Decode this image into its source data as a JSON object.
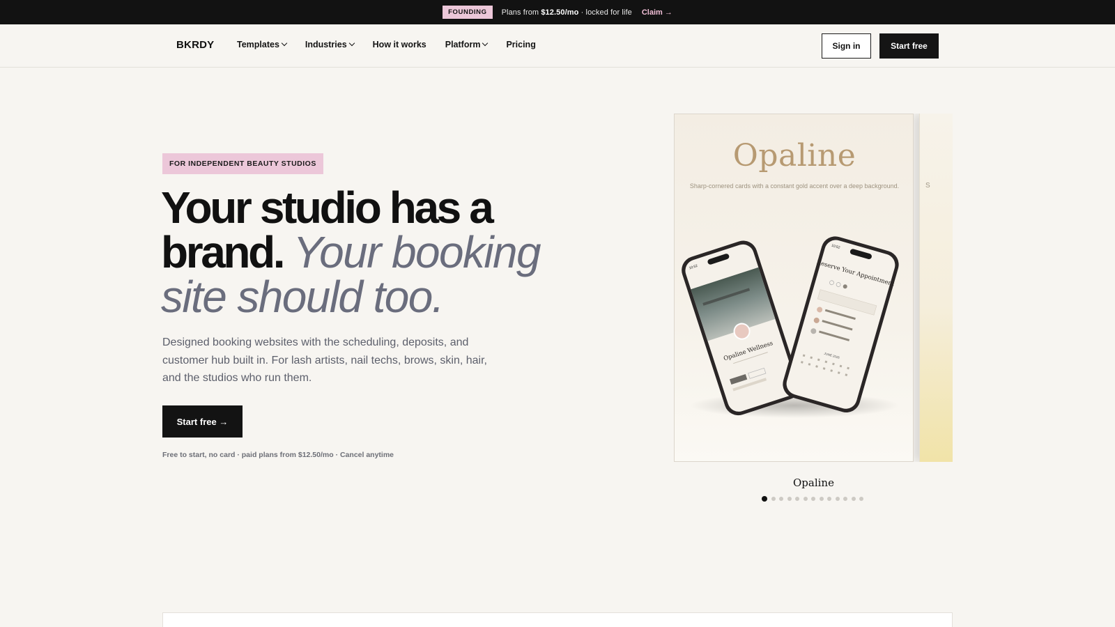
{
  "announcement": {
    "badge": "FOUNDING",
    "text_prefix": "Plans from ",
    "price": "$12.50/mo",
    "text_suffix": " · locked for life",
    "cta": "Claim →"
  },
  "nav": {
    "logo": "BKRDY",
    "links": [
      {
        "label": "Templates",
        "dropdown": true
      },
      {
        "label": "Industries",
        "dropdown": true
      },
      {
        "label": "How it works",
        "dropdown": false
      },
      {
        "label": "Platform",
        "dropdown": true
      },
      {
        "label": "Pricing",
        "dropdown": false
      }
    ],
    "sign_in": "Sign in",
    "start_free": "Start free"
  },
  "hero": {
    "eyebrow": "FOR INDEPENDENT BEAUTY STUDIOS",
    "headline_bold_1": "Your studio has a",
    "headline_bold_2": "brand.",
    "headline_italic_1": "Your booking",
    "headline_italic_2": "site should too.",
    "subheading": "Designed booking websites with the scheduling, deposits, and customer hub built in. For lash artists, nail techs, brows, skin, hair, and the studios who run them.",
    "cta": "Start free →",
    "fine_print": "Free to start, no card · paid plans from $12.50/mo · Cancel anytime"
  },
  "carousel": {
    "active_template": {
      "title": "Opaline",
      "description": "Sharp-cornered cards with a constant gold accent over a deep background.",
      "phone_left": {
        "time": "10:52",
        "studio_name": "Opaline Wellness"
      },
      "phone_right": {
        "time": "10:52",
        "heading": "Reserve Your Appointment",
        "date_label": "JUNE 2026"
      }
    },
    "next_peek_letter": "S",
    "caption": "Opaline",
    "slide_count": 13,
    "active_index": 0
  },
  "colors": {
    "accent_pink": "#ecc7d9",
    "dark": "#131313",
    "background": "#f7f5f1",
    "italic_grey": "#6a6d7d",
    "gold": "#b79a72"
  }
}
